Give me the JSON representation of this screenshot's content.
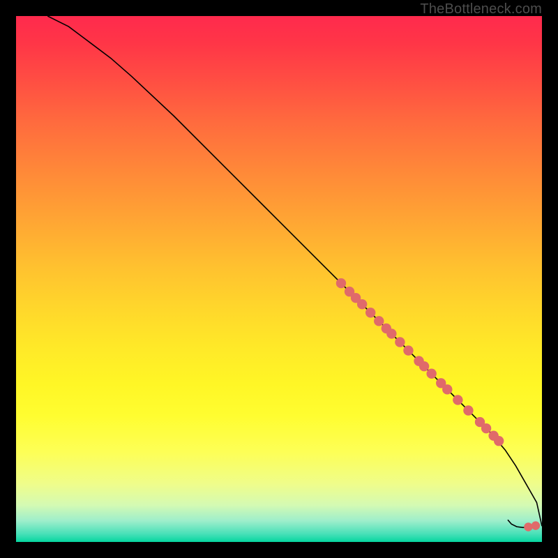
{
  "attribution": "TheBottleneck.com",
  "colors": {
    "marker": "#e06a6a",
    "curve": "#000000",
    "background_start": "#ff2a4d",
    "background_end": "#05d69f"
  },
  "chart_data": {
    "type": "line",
    "title": "",
    "xlabel": "",
    "ylabel": "",
    "xlim": [
      0,
      100
    ],
    "ylim": [
      0,
      100
    ],
    "curve": {
      "name": "bottleneck-curve",
      "x": [
        6,
        8,
        10,
        12,
        14,
        18,
        22,
        30,
        40,
        50,
        60,
        70,
        80,
        90,
        93,
        95,
        97,
        99,
        100
      ],
      "y": [
        100,
        99,
        98,
        96.5,
        95,
        92,
        88.5,
        81,
        71,
        61,
        51,
        41,
        31,
        21,
        17.5,
        14.5,
        11,
        7.5,
        3
      ]
    },
    "tail": {
      "name": "tail-hook",
      "x": [
        93.5,
        94.2,
        95.2,
        96.4,
        97.6,
        98.6
      ],
      "y": [
        4.2,
        3.4,
        2.9,
        2.75,
        2.85,
        3.05
      ]
    },
    "series": [
      {
        "name": "on-curve-markers",
        "type": "scatter",
        "x": [
          61.8,
          63.4,
          64.6,
          65.8,
          67.4,
          69.0,
          70.4,
          71.4,
          73.0,
          74.6,
          76.6,
          77.6,
          79.0,
          80.8,
          82.0,
          84.0,
          86.0,
          88.2,
          89.4,
          90.8,
          91.8
        ],
        "y": [
          49.2,
          47.6,
          46.4,
          45.2,
          43.6,
          42.0,
          40.6,
          39.6,
          38.0,
          36.4,
          34.4,
          33.4,
          32.0,
          30.2,
          29.0,
          27.0,
          25.0,
          22.8,
          21.6,
          20.2,
          19.2
        ]
      },
      {
        "name": "tail-markers",
        "type": "scatter",
        "x": [
          97.4,
          98.8
        ],
        "y": [
          2.85,
          3.1
        ]
      }
    ]
  }
}
